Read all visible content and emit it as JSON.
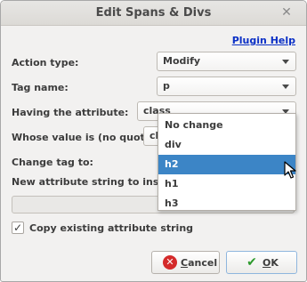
{
  "window": {
    "title": "Edit Spans & Divs",
    "close_glyph": "✕"
  },
  "help_link": "Plugin Help",
  "form": {
    "action_type": {
      "label": "Action type:",
      "value": "Modify"
    },
    "tag_name": {
      "label": "Tag name:",
      "value": "p"
    },
    "having_attribute": {
      "label": "Having the attribute:",
      "value": "class"
    },
    "whose_value": {
      "label": "Whose value is (no quotes):",
      "value": "ch"
    },
    "change_tag_to": {
      "label": "Change tag to:"
    },
    "new_attribute": {
      "label": "New attribute string to insert (e",
      "value": ""
    },
    "copy_existing": {
      "label": "Copy existing attribute string",
      "checked": true,
      "check_glyph": "✓"
    }
  },
  "dropdown": {
    "options": [
      "No change",
      "div",
      "h2",
      "h1",
      "h3"
    ],
    "selected": "h2",
    "selected_color": "#3c85c6"
  },
  "buttons": {
    "cancel": {
      "label_u": "C",
      "label_rest": "ancel",
      "icon": "cancel-icon"
    },
    "ok": {
      "label_u": "O",
      "label_rest": "K",
      "icon": "check-icon"
    }
  }
}
